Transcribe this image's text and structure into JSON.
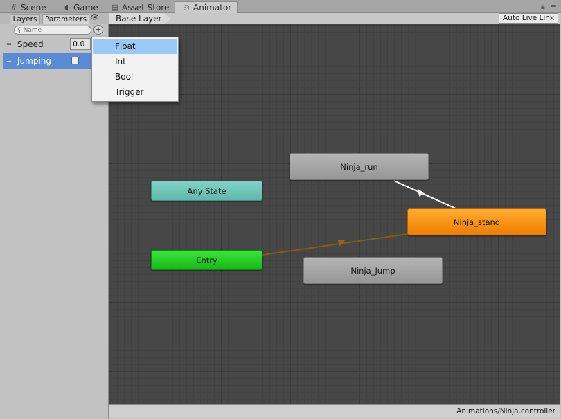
{
  "tabs": [
    {
      "label": "Scene",
      "icon": "grid-icon"
    },
    {
      "label": "Game",
      "icon": "pacman-icon"
    },
    {
      "label": "Asset Store",
      "icon": "store-icon"
    },
    {
      "label": "Animator",
      "icon": "animator-icon"
    }
  ],
  "left_panel": {
    "tabs": [
      "Layers",
      "Parameters"
    ],
    "search_placeholder": "Name",
    "parameters": [
      {
        "name": "Speed",
        "value": "0.0"
      },
      {
        "name": "Jumping",
        "value": false
      }
    ]
  },
  "dropdown": {
    "items": [
      "Float",
      "Int",
      "Bool",
      "Trigger"
    ]
  },
  "canvas": {
    "breadcrumb": "Base Layer",
    "auto_live_link": "Auto Live Link",
    "states": {
      "any_state": "Any State",
      "entry": "Entry",
      "run": "Ninja_run",
      "jump": "Ninja_Jump",
      "stand": "Ninja_stand"
    }
  },
  "status": {
    "path": "Animations/Ninja.controller"
  },
  "colors": {
    "any_state": "#6fc5b8",
    "entry": "#22cc22",
    "default_state": "#ff9400",
    "selected_param": "#5a8bd6",
    "menu_highlight": "#99c9f4"
  }
}
